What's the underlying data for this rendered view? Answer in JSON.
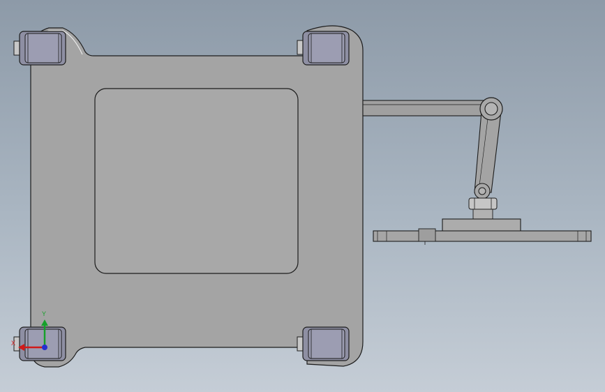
{
  "viewport": {
    "background_top": "#8d9aa8",
    "background_bottom": "#c5cdd6"
  },
  "triad": {
    "x_label": "X",
    "y_label": "Y",
    "x_color": "#d11a1a",
    "y_color": "#16a02a",
    "z_color": "#2630d0"
  },
  "model": {
    "plate_color": "#a4a4a4",
    "panel_color": "#a8a8a8",
    "wheel_color": "#8e8fa3",
    "edge_color": "#1c1c1c"
  }
}
